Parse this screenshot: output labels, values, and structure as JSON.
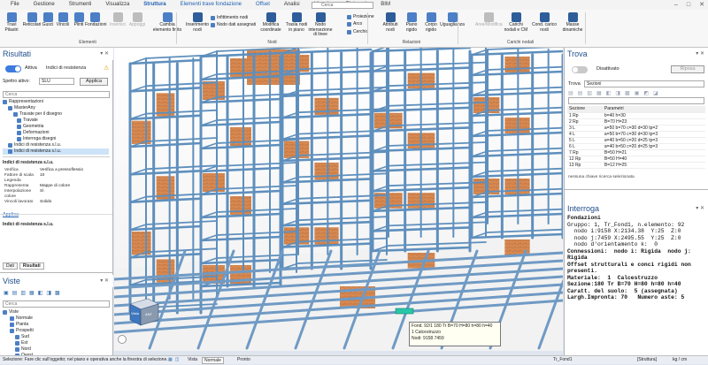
{
  "menu": [
    "File",
    "Gestione",
    "Strumenti",
    "Visualizza",
    "Struttura",
    "Elementi trave fondazione",
    "Offset",
    "Analisi",
    "Librerie",
    "Elaborati",
    "BIM"
  ],
  "menu_active": "Struttura",
  "menu_search": "Cerca",
  "ribbon": {
    "big": [
      {
        "l1": "Travi",
        "l2": "Pilastri"
      },
      {
        "l1": "Reticolari",
        "l2": ""
      },
      {
        "l1": "Gusci",
        "l2": ""
      },
      {
        "l1": "Vincoli",
        "l2": ""
      },
      {
        "l1": "Plinti",
        "l2": ""
      },
      {
        "l1": "Fondazioni",
        "l2": ""
      },
      {
        "l1": "Inserisci",
        "l2": ""
      },
      {
        "l1": "Appoggi",
        "l2": ""
      },
      {
        "l1": "Cambia",
        "l2": "elemento finito"
      },
      {
        "l1": "Inserimento",
        "l2": "nodi"
      },
      {
        "l1": "Modifica",
        "l2": "coordinate"
      },
      {
        "l1": "Trasla nodi",
        "l2": "in piano"
      },
      {
        "l1": "Nodo intersezione",
        "l2": "di linee"
      },
      {
        "l1": "Attributi",
        "l2": "nodi"
      },
      {
        "l1": "Piano",
        "l2": "rigido"
      },
      {
        "l1": "Corpo",
        "l2": "rigido"
      },
      {
        "l1": "Uguaglianza",
        "l2": ""
      },
      {
        "l1": "Aree/Modifica",
        "l2": ""
      },
      {
        "l1": "Carichi",
        "l2": "nodali e CM"
      },
      {
        "l1": "Cond. carico",
        "l2": "nodi"
      },
      {
        "l1": "Masse",
        "l2": "dinamiche"
      }
    ],
    "small": [
      "Infittimento nodi",
      "Nodo dati assegnati",
      "Proiezione",
      "Arco",
      "Cerchio"
    ],
    "groups": [
      "Elementi",
      "Nodi",
      "Relazioni",
      "Carichi nodali"
    ]
  },
  "left": {
    "title": "Risultati",
    "toggle_label": "Attiva",
    "indici_label": "Indici di resistenza",
    "spettro_label": "Spettro attivo:",
    "spettro_value": "SLU",
    "applica": "Applica",
    "search": "Cerca",
    "tree": [
      "Rappresentazioni",
      "MasterAny",
      "Travate per il disegno",
      "Travate",
      "Geometria",
      "Deformazioni",
      "Interroga disegni",
      "Indici di resistenza s.l.u.",
      "Indici di resistenza s.l.u."
    ],
    "props_title": "Indici di resistenza s.l.u.",
    "props": [
      [
        "Verifica",
        "Verifica a pressoflessio"
      ],
      [
        "Fattore di scala",
        "10"
      ],
      [
        "Legenda",
        ""
      ],
      [
        "Rappresenta",
        "Mappe di colore"
      ],
      [
        "Interpolazione colore",
        "Sì"
      ],
      [
        "Vincoli lavorato",
        "Solido"
      ]
    ],
    "applica2": "Applica",
    "prop_footer": "Indici di resistenza s.l.u.",
    "tabs": [
      "Dati",
      "Risultati"
    ],
    "viste_title": "Viste",
    "viste_search": "Cerca",
    "viste_tree": [
      "Viste",
      "Normale",
      "Pianta",
      "Prospetti",
      "Sud",
      "Est",
      "Nord",
      "Ovest",
      "Vista 1"
    ]
  },
  "right": {
    "title": "Trova",
    "toggle_label": "Disattivato",
    "btn": "Riposa",
    "trova_label": "Trova",
    "trova_value": "Sezioni",
    "cols": [
      "Sezione",
      "Parametri"
    ],
    "rows": [
      [
        "1 Rp",
        "b=40 h=30"
      ],
      [
        "2 Rp",
        "B=70 H=23"
      ],
      [
        "3 L",
        "a=50 b=70 c=30 d=30 tp=2"
      ],
      [
        "4 L",
        "a=50 b=70 c=30 d=30 tp=3"
      ],
      [
        "5 L",
        "a=40 b=50 c=20 d=25 tp=3"
      ],
      [
        "6 L",
        "a=40 b=50 c=20 d=25 tp=3"
      ],
      [
        "7 Rp",
        "B=50 H=21"
      ],
      [
        "12 Rp",
        "B=50 H=40"
      ],
      [
        "13 Rp",
        "B=12 H=25"
      ]
    ],
    "status": "nessuna chiave ricerca selezionata",
    "interroga_title": "Interroga",
    "interroga_lines": [
      {
        "t": "Fondazioni",
        "b": true
      },
      {
        "t": "Gruppo: 1, Tr_Fond1, n.elemento: 92",
        "b": false
      },
      {
        "t": "  nodo i:9158 X:2134.38  Y:25  Z:0",
        "b": false
      },
      {
        "t": "  nodo j:7459 X:2495.55  Y:25  Z:0",
        "b": false
      },
      {
        "t": "  nodo d'orientamento k:  0",
        "b": false
      },
      {
        "t": "Connessioni:  nodo i: Rigida  nodo j: Rigida",
        "b": true
      },
      {
        "t": "Offset strutturali e conci rigidi non presenti.",
        "b": true
      },
      {
        "t": "Materiale:  1  Calcestruzzo",
        "b": true
      },
      {
        "t": "Sezione:180 Tr B=70 H=80 h=80 h=40",
        "b": true
      },
      {
        "t": "Caratt. del suolo:  5 (assegnata)",
        "b": true
      },
      {
        "t": "Largh.Impronta: 70   Numero aste: 5",
        "b": true
      }
    ]
  },
  "tooltip": [
    "Fond. 92/1 180 Tr B=70 H=80 h=80 h=40",
    "1 Calcestruzzo",
    "Nodi: 9158 7459"
  ],
  "status": {
    "left": "Selezione: Fare clic sull'oggetto; nel piano e operativa anche la finestra di selezione.",
    "vista": "Vista",
    "vista_value": "Normale",
    "pronto": "Pronto",
    "right1": "Tr_Fond1",
    "right2": "[Struttura]",
    "right3": "kg / cm"
  },
  "viewcube": [
    "Vista",
    "ANT"
  ],
  "colors": {
    "accent": "#1e5fb4",
    "beam": "#5e8fbd",
    "wall": "#d8894e",
    "ground": "#eeeeee"
  }
}
